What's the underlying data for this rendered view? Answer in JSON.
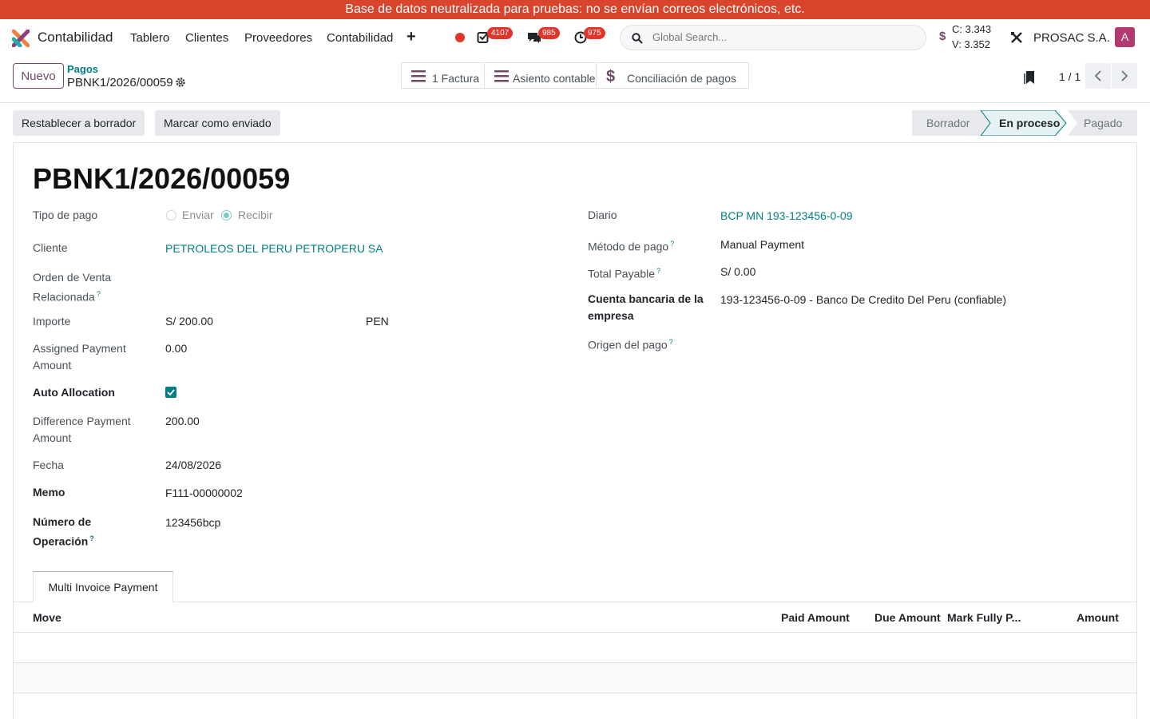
{
  "banner": "Base de datos neutralizada para pruebas: no se envían correos electrónicos, etc.",
  "navbar": {
    "app_name": "Contabilidad",
    "menu": [
      "Tablero",
      "Clientes",
      "Proveedores",
      "Contabilidad"
    ],
    "badges": {
      "activities": "4107",
      "messages": "985",
      "timers": "975"
    },
    "search_placeholder": "Global Search...",
    "rate_c": "C: 3.343",
    "rate_v": "V: 3.352",
    "currency_sign": "$",
    "company": "PROSAC S.A.",
    "avatar_letter": "A"
  },
  "control": {
    "new_label": "Nuevo",
    "breadcrumb_parent": "Pagos",
    "breadcrumb_current": "PBNK1/2026/00059",
    "smart_buttons": [
      "1 Factura",
      "Asiento contable",
      "Conciliación de pagos"
    ],
    "pager": "1 / 1"
  },
  "actions": {
    "reset_draft": "Restablecer a borrador",
    "mark_sent": "Marcar como enviado"
  },
  "statusbar": [
    "Borrador",
    "En proceso",
    "Pagado"
  ],
  "record": {
    "title": "PBNK1/2026/00059",
    "left": {
      "tipo_pago_label": "Tipo de pago",
      "enviar": "Enviar",
      "recibir": "Recibir",
      "cliente_label": "Cliente",
      "cliente_value": "PETROLEOS DEL PERU PETROPERU SA",
      "orden_label_1": "Orden de Venta",
      "orden_label_2": "Relacionada",
      "importe_label": "Importe",
      "importe_value": "S/ 200.00",
      "importe_currency": "PEN",
      "assigned_label_1": "Assigned Payment",
      "assigned_label_2": "Amount",
      "assigned_value": "0.00",
      "auto_label": "Auto Allocation",
      "diff_label_1": "Difference Payment",
      "diff_label_2": "Amount",
      "diff_value": "200.00",
      "fecha_label": "Fecha",
      "fecha_value": "24/08/2026",
      "memo_label": "Memo",
      "memo_value": "F111-00000002",
      "numop_label_1": "Número de",
      "numop_label_2": "Operación",
      "numop_value": "123456bcp"
    },
    "right": {
      "diario_label": "Diario",
      "diario_value": "BCP MN 193-123456-0-09",
      "metodo_label": "Método de pago",
      "metodo_value": "Manual Payment",
      "total_label": "Total Payable",
      "total_value": "S/ 0.00",
      "cuenta_label_1": "Cuenta bancaria de la",
      "cuenta_label_2": "empresa",
      "cuenta_value": "193-123456-0-09 - Banco De Credito Del Peru (confiable)",
      "origen_label": "Origen del pago"
    },
    "tab_label": "Multi Invoice Payment",
    "columns": [
      "Move",
      "Paid Amount",
      "Due Amount",
      "Mark Fully P...",
      "Amount"
    ]
  }
}
